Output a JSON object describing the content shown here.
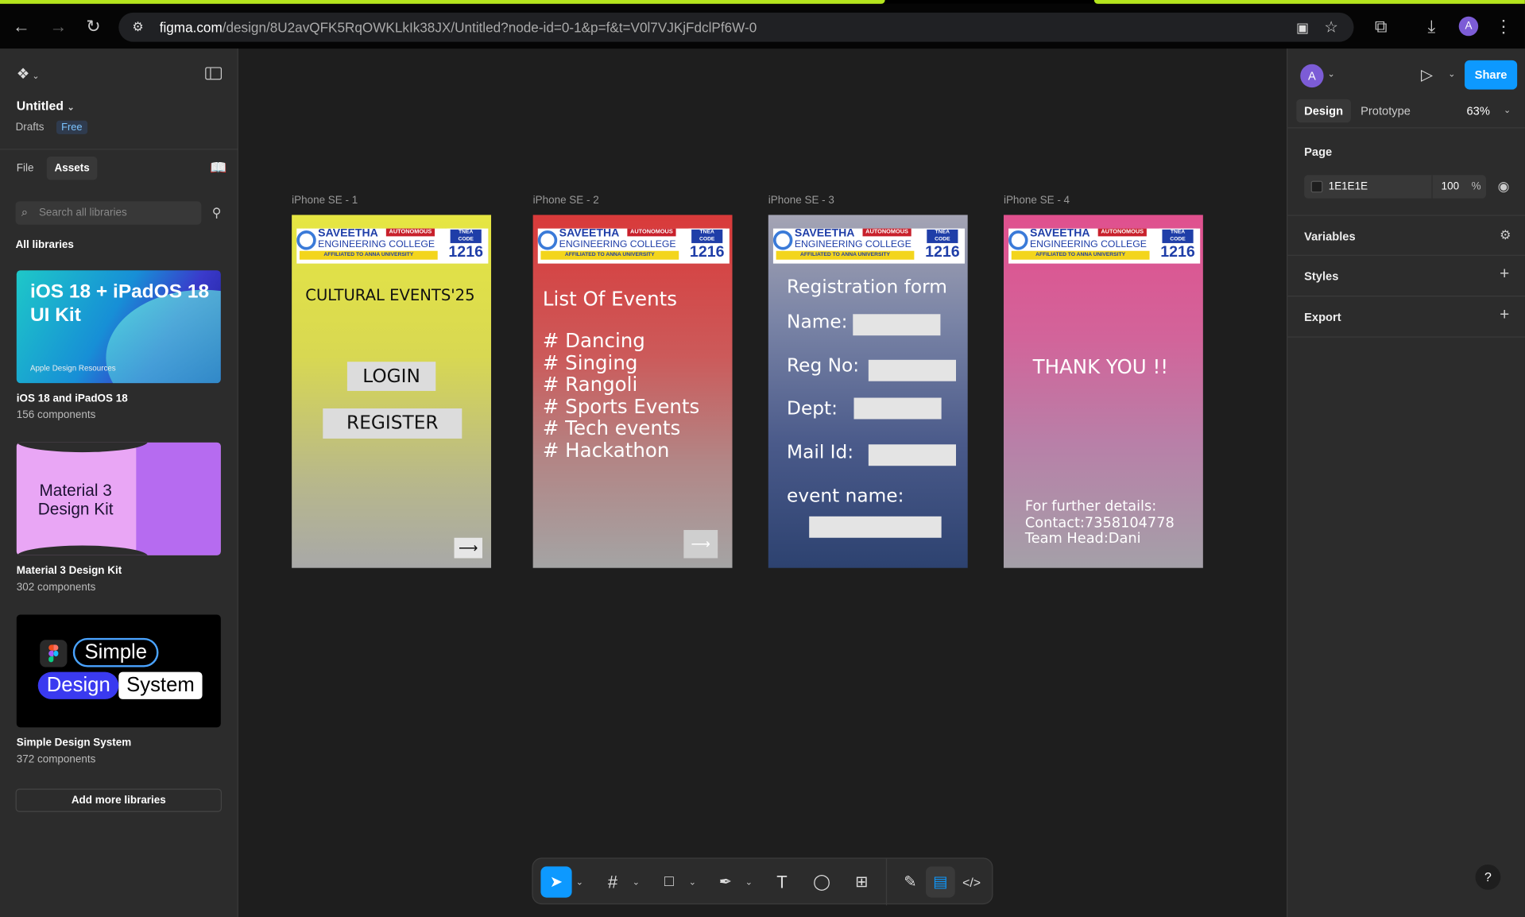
{
  "browser": {
    "url_domain": "figma.com",
    "url_path": "/design/8U2avQFK5RqOWKLkIk38JX/Untitled?node-id=0-1&p=f&t=V0l7VJKjFdclPf6W-0",
    "avatar_letter": "A"
  },
  "left_panel": {
    "file_title": "Untitled",
    "drafts_label": "Drafts",
    "plan_badge": "Free",
    "tabs": [
      "File",
      "Assets"
    ],
    "search_placeholder": "Search all libraries",
    "section_title": "All libraries",
    "libraries": [
      {
        "name": "iOS 18 and iPadOS 18",
        "count": "156 components",
        "thumb_title": "iOS 18 + iPadOS 18\nUI Kit",
        "thumb_caption": "Apple Design Resources"
      },
      {
        "name": "Material 3 Design Kit",
        "count": "302 components",
        "thumb_title": "Material 3\nDesign Kit"
      },
      {
        "name": "Simple Design System",
        "count": "372 components",
        "thumb_words": [
          "Simple",
          "Design",
          "System"
        ]
      }
    ],
    "add_button": "Add more libraries"
  },
  "canvas": {
    "college_name": [
      "SAVEETHA",
      "ENGINEERING COLLEGE"
    ],
    "college_tag": "AUTONOMOUS",
    "college_affiliation": "AFFILIATED TO ANNA UNIVERSITY",
    "tnea_label": "TNEA CODE",
    "tnea_code": "1216",
    "frames": [
      {
        "label": "iPhone SE - 1",
        "title": "CULTURAL EVENTS'25",
        "buttons": [
          "LOGIN",
          "REGISTER"
        ],
        "arrow": "⟶"
      },
      {
        "label": "iPhone SE - 2",
        "title": "List Of Events",
        "items": [
          "# Dancing",
          "# Singing",
          "# Rangoli",
          "# Sports Events",
          "# Tech events",
          "# Hackathon"
        ],
        "arrow": "⟶"
      },
      {
        "label": "iPhone SE - 3",
        "title": "Registration form",
        "fields": [
          "Name:",
          "Reg No:",
          "Dept:",
          "Mail Id:",
          "event name:"
        ]
      },
      {
        "label": "iPhone SE - 4",
        "title": "THANK YOU !!",
        "details": [
          "For further details:",
          "Contact:7358104778",
          "Team Head:Dani"
        ]
      }
    ]
  },
  "right_panel": {
    "avatar_letter": "A",
    "share_label": "Share",
    "tabs": [
      "Design",
      "Prototype"
    ],
    "zoom": "63%",
    "page_heading": "Page",
    "page_color": "1E1E1E",
    "page_opacity": "100",
    "percent": "%",
    "sections": [
      "Variables",
      "Styles",
      "Export"
    ]
  },
  "colors": {
    "accent_blue": "#0d99ff",
    "highlight_green": "#b5e61d",
    "canvas_bg": "#1e1e1e"
  },
  "help_label": "?"
}
